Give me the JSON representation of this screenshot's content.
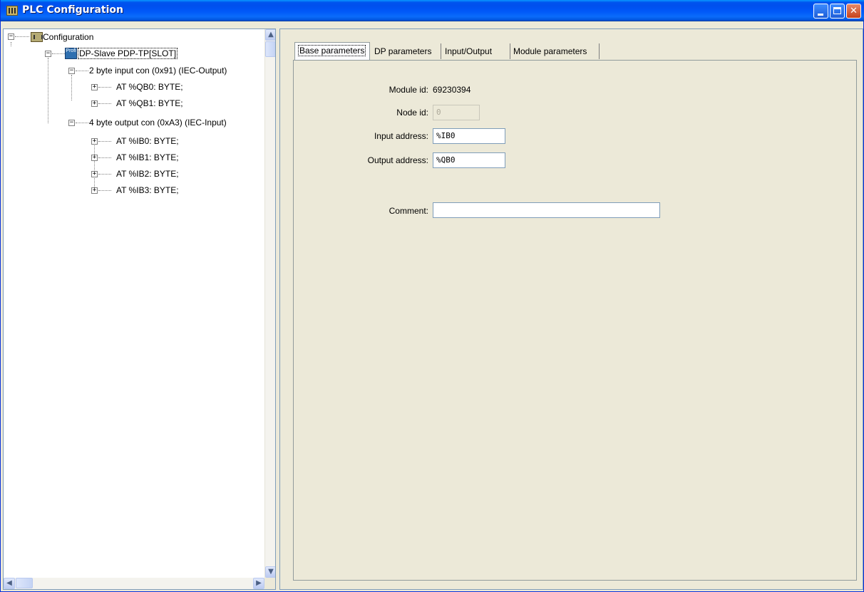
{
  "window": {
    "title": "PLC Configuration"
  },
  "tree": {
    "root": "Configuration",
    "slave": "DP-Slave PDP-TP[SLOT]",
    "modules": [
      {
        "label": "2  byte input con  (0x91) (IEC-Output)",
        "channels": [
          "AT %QB0: BYTE;",
          "AT %QB1: BYTE;"
        ]
      },
      {
        "label": "4  byte output con (0xA3) (IEC-Input)",
        "channels": [
          "AT %IB0: BYTE;",
          "AT %IB1: BYTE;",
          "AT %IB2: BYTE;",
          "AT %IB3: BYTE;"
        ]
      }
    ]
  },
  "tabs": [
    "Base parameters",
    "DP parameters",
    "Input/Output",
    "Module parameters"
  ],
  "form": {
    "module_id_label": "Module id:",
    "module_id_value": "69230394",
    "node_id_label": "Node id:",
    "node_id_value": "0",
    "input_address_label": "Input address:",
    "input_address_value": "%IB0",
    "output_address_label": "Output address:",
    "output_address_value": "%QB0",
    "comment_label": "Comment:",
    "comment_value": ""
  }
}
